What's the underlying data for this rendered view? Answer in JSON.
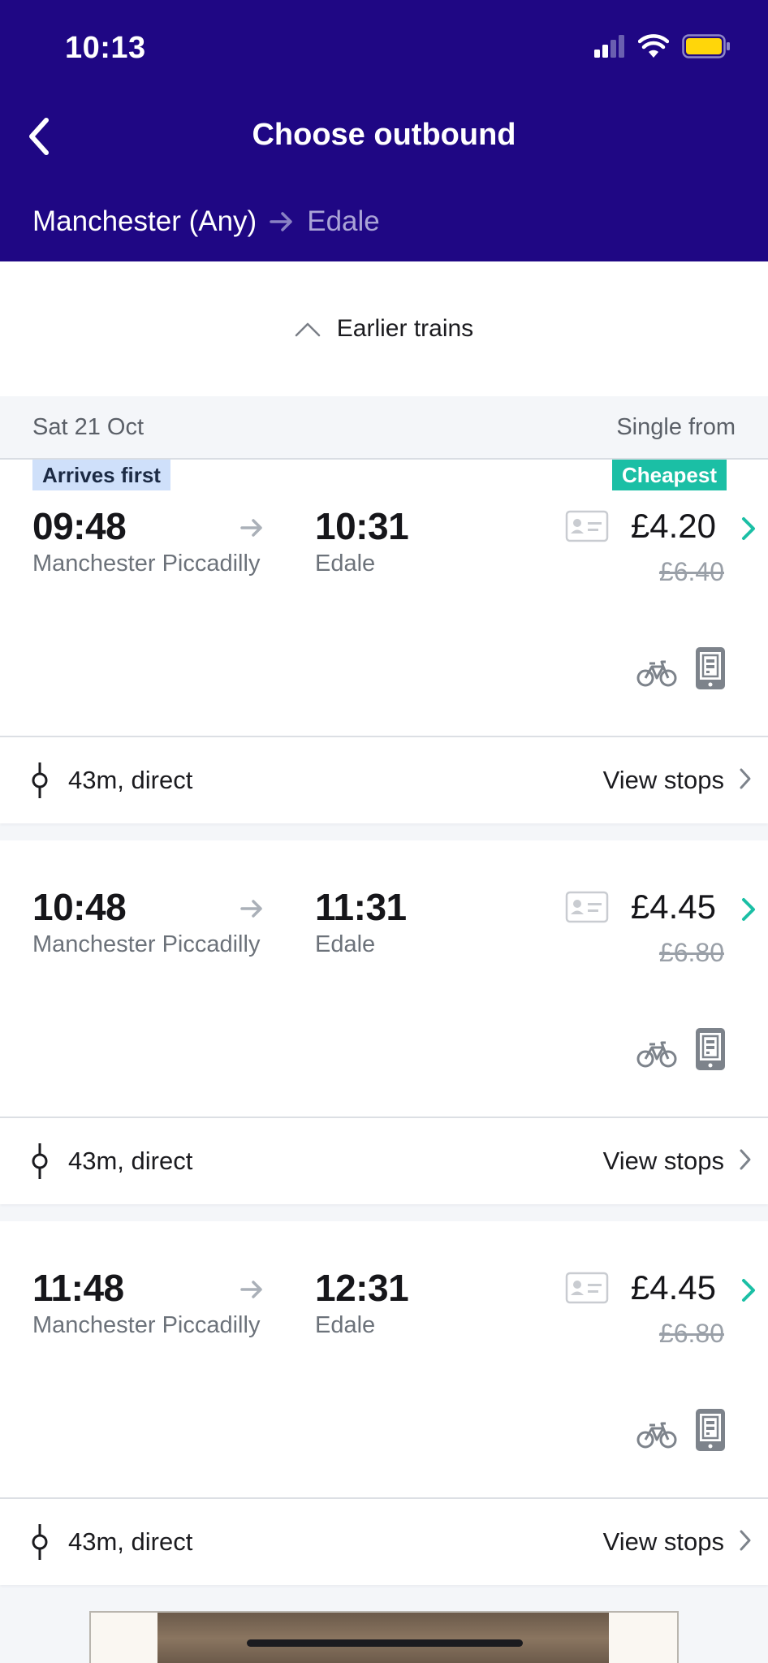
{
  "status_bar": {
    "time": "10:13"
  },
  "header": {
    "title": "Choose outbound",
    "origin": "Manchester (Any)",
    "destination": "Edale"
  },
  "earlier_label": "Earlier trains",
  "date_row": {
    "date": "Sat 21 Oct",
    "price_label": "Single from"
  },
  "journeys": [
    {
      "badge_left": "Arrives first",
      "badge_right": "Cheapest",
      "depart_time": "09:48",
      "depart_station": "Manchester Piccadilly",
      "arrive_time": "10:31",
      "arrive_station": "Edale",
      "price": "£4.20",
      "old_price": "£6.40",
      "duration": "43m, direct",
      "view_stops": "View stops"
    },
    {
      "depart_time": "10:48",
      "depart_station": "Manchester Piccadilly",
      "arrive_time": "11:31",
      "arrive_station": "Edale",
      "price": "£4.45",
      "old_price": "£6.80",
      "duration": "43m, direct",
      "view_stops": "View stops"
    },
    {
      "depart_time": "11:48",
      "depart_station": "Manchester Piccadilly",
      "arrive_time": "12:31",
      "arrive_station": "Edale",
      "price": "£4.45",
      "old_price": "£6.80",
      "duration": "43m, direct",
      "view_stops": "View stops"
    }
  ],
  "colors": {
    "brand": "#1f0784",
    "accent": "#1bbfa5",
    "badge_arrives": "#cfe0fa"
  },
  "icons": [
    "signal-icon",
    "wifi-icon",
    "battery-icon",
    "back-chevron-icon",
    "arrow-right-icon",
    "chevron-up-icon",
    "railcard-icon",
    "chevron-right-icon",
    "bike-icon",
    "mobile-ticket-icon",
    "stop-marker-icon"
  ]
}
